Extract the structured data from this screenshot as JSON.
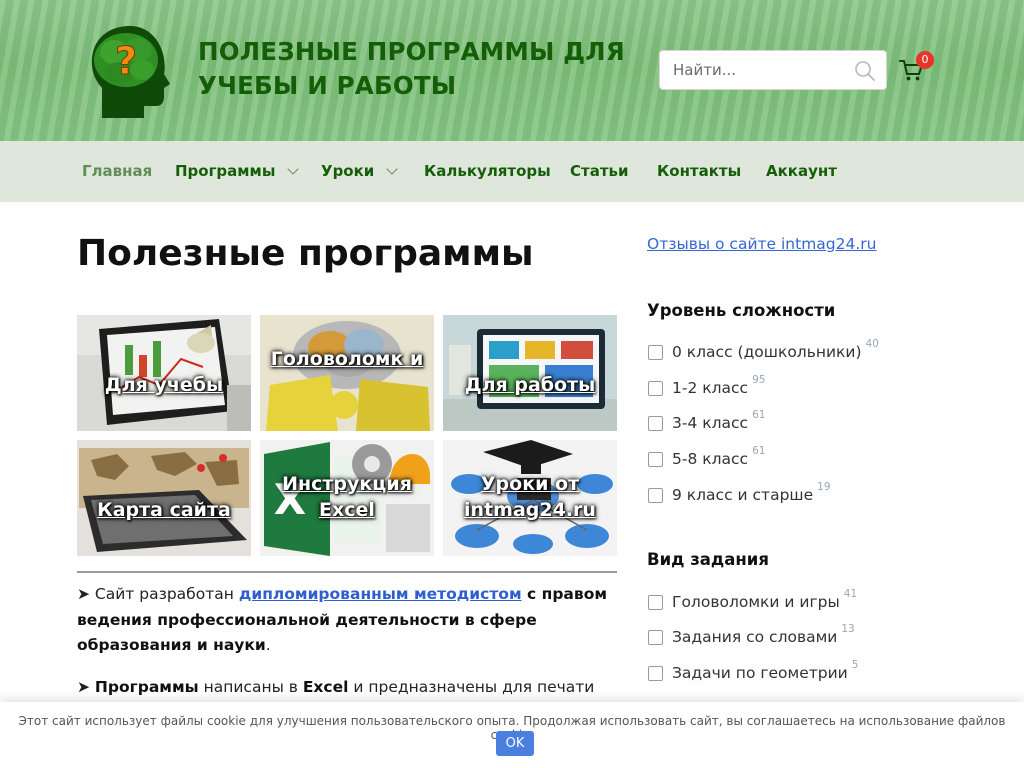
{
  "header": {
    "site_title": "ПОЛЕЗНЫЕ ПРОГРАММЫ ДЛЯ УЧЕБЫ И РАБОТЫ",
    "search_placeholder": "Найти...",
    "cart_count": "0",
    "logo_icon": "brain-head-question-icon"
  },
  "nav": {
    "items": [
      {
        "label": "Главная",
        "active": true
      },
      {
        "label": "Программы",
        "dropdown": true
      },
      {
        "label": "Уроки",
        "dropdown": true
      },
      {
        "label": "Калькуляторы"
      },
      {
        "label": "Статьи"
      },
      {
        "label": "Контакты"
      },
      {
        "label": "Аккаунт"
      }
    ]
  },
  "main": {
    "title": "Полезные программы",
    "tiles": [
      {
        "label": "Для учебы"
      },
      {
        "label": "Головоломк и"
      },
      {
        "label": "Для работы"
      },
      {
        "label": "Карта сайта"
      },
      {
        "label": "Инструкция Excel"
      },
      {
        "label": "Уроки от intmag24.ru"
      }
    ],
    "para1": {
      "prefix": "➤ Сайт разработан ",
      "link": "дипломированным методистом",
      "bold_tail": " с правом ведения профессиональной деятельности в сфере образования и науки",
      "end": "."
    },
    "para2": {
      "prefix": "➤ ",
      "bold1": "Программы",
      "mid": " написаны в ",
      "bold2": "Excel",
      "tail": " и предназначены для печати на"
    }
  },
  "sidebar": {
    "reviews_link": "Отзывы о сайте intmag24.ru",
    "level_heading": "Уровень сложности",
    "levels": [
      {
        "label": "0 класс (дошкольники)",
        "count": "40"
      },
      {
        "label": "1-2 класс",
        "count": "95"
      },
      {
        "label": "3-4 класс",
        "count": "61"
      },
      {
        "label": "5-8 класс",
        "count": "61"
      },
      {
        "label": "9 класс и старше",
        "count": "19"
      }
    ],
    "type_heading": "Вид задания",
    "types": [
      {
        "label": "Головоломки и игры",
        "count": "41"
      },
      {
        "label": "Задания со словами",
        "count": "13"
      },
      {
        "label": "Задачи по геометрии",
        "count": "5"
      }
    ]
  },
  "cookie": {
    "text": "Этот сайт использует файлы cookie для улучшения пользовательского опыта. Продолжая использовать сайт, вы соглашаетесь на использование файлов cookie.",
    "ok_label": "OK"
  },
  "colors": {
    "header_green": "#7fbf7b",
    "title_green": "#155e08",
    "nav_bg": "#dfe7dc",
    "link_blue": "#3567d4",
    "badge_red": "#e8352b",
    "button_blue": "#4a7fe0"
  }
}
